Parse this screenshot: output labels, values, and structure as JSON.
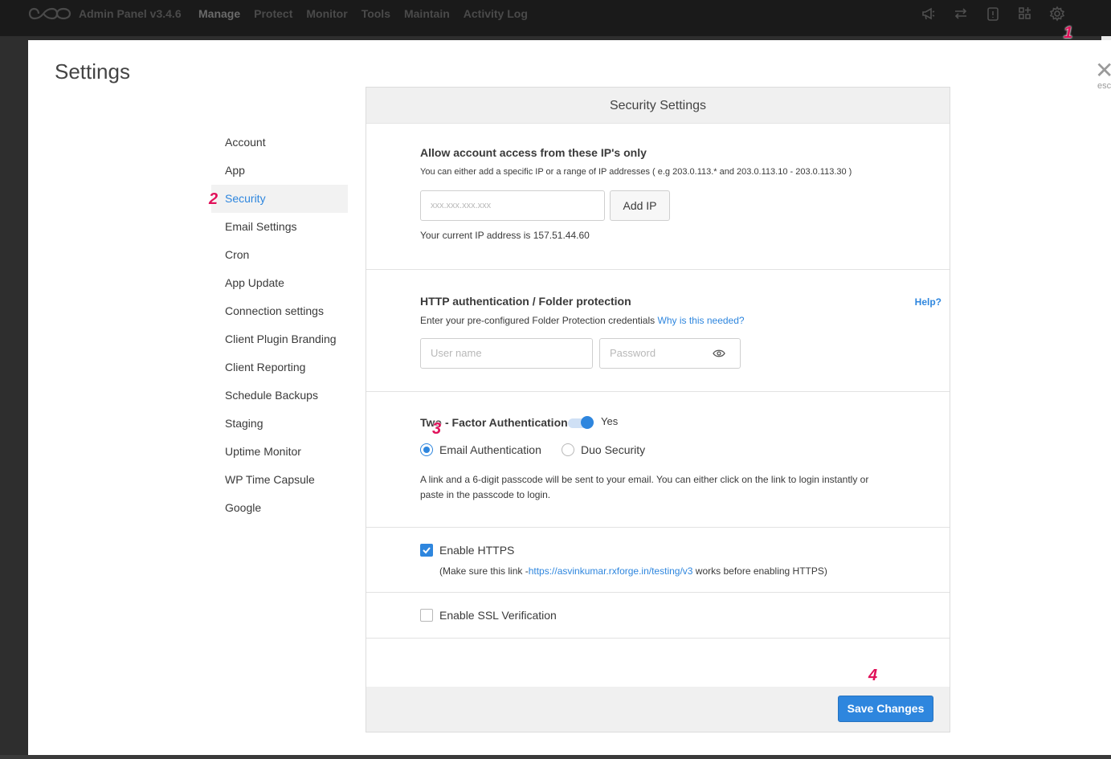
{
  "topbar": {
    "app_title": "Admin Panel v3.4.6",
    "nav": [
      "Manage",
      "Protect",
      "Monitor",
      "Tools",
      "Maintain",
      "Activity Log"
    ],
    "icons": [
      "megaphone-icon",
      "transfer-icon",
      "clipboard-icon",
      "addons-icon",
      "gear-icon"
    ]
  },
  "modal": {
    "title": "Settings",
    "close_label": "esc"
  },
  "sidebar": {
    "items": [
      {
        "label": "Account"
      },
      {
        "label": "App"
      },
      {
        "label": "Security"
      },
      {
        "label": "Email Settings"
      },
      {
        "label": "Cron"
      },
      {
        "label": "App Update"
      },
      {
        "label": "Connection settings"
      },
      {
        "label": "Client Plugin Branding"
      },
      {
        "label": "Client Reporting"
      },
      {
        "label": "Schedule Backups"
      },
      {
        "label": "Staging"
      },
      {
        "label": "Uptime Monitor"
      },
      {
        "label": "WP Time Capsule"
      },
      {
        "label": "Google"
      }
    ],
    "active": "Security"
  },
  "panel": {
    "header": "Security Settings",
    "ip_access": {
      "title": "Allow account access from these IP's only",
      "subtitle": "You can either add a specific IP or a range of IP addresses ( e.g 203.0.113.* and 203.0.113.10 - 203.0.113.30 )",
      "placeholder": "xxx.xxx.xxx.xxx",
      "add_button": "Add IP",
      "current_ip": "Your current IP address is 157.51.44.60"
    },
    "http_auth": {
      "title": "HTTP authentication / Folder protection",
      "help": "Help?",
      "subtitle": "Enter your pre-configured Folder Protection credentials",
      "why_link": "Why is this needed?",
      "username_placeholder": "User name",
      "password_placeholder": "Password"
    },
    "two_factor": {
      "title_a": "Two",
      "title_b": "- Factor Authentication",
      "toggle_label": "Yes",
      "toggle_on": true,
      "options": [
        "Email Authentication",
        "Duo Security"
      ],
      "selected": "Email Authentication",
      "description_line1": "A link and a 6-digit passcode will be sent to your email. You can either click on the link to login instantly or",
      "description_line2": "paste in the passcode to login."
    },
    "https": {
      "label": "Enable HTTPS",
      "checked": true,
      "note_prefix": "(Make sure this link -",
      "note_link": "https://asvinkumar.rxforge.in/testing/v3",
      "note_suffix": " works before enabling HTTPS)"
    },
    "ssl": {
      "label": "Enable SSL Verification",
      "checked": false
    },
    "save_button": "Save Changes"
  },
  "annotations": [
    "1",
    "2",
    "3",
    "4"
  ],
  "colors": {
    "accent": "#2e86de",
    "annotation": "#e0125a",
    "topbar": "#1a1a1a"
  }
}
